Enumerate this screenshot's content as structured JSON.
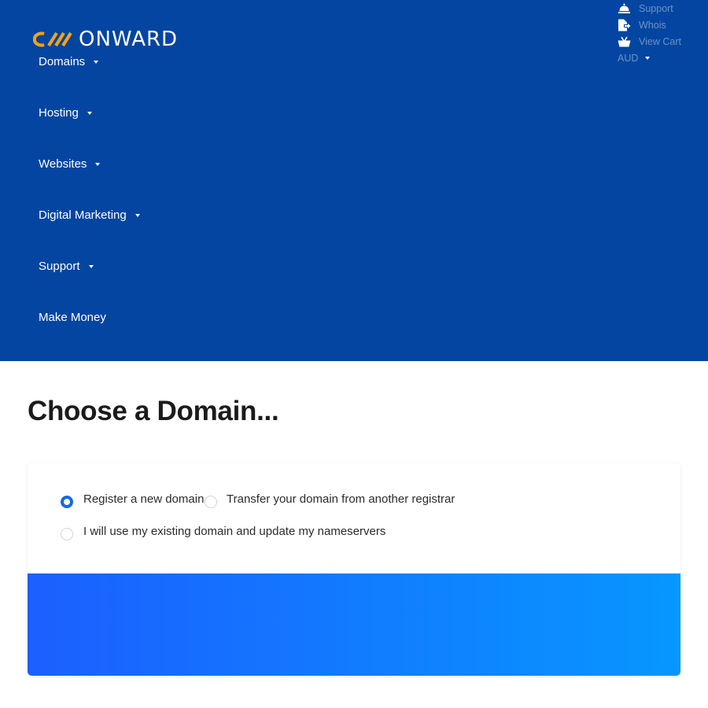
{
  "brand": {
    "name": "ONWARD",
    "logo_colors": [
      "#f0a21c"
    ]
  },
  "colors": {
    "header_bg": "#0345a1",
    "accent": "#1468e6",
    "gradient_start": "#1c5fff",
    "gradient_end": "#0797ff"
  },
  "topbar": {
    "links": [
      {
        "label": "Support",
        "icon": "bell-icon"
      },
      {
        "label": "Whois",
        "icon": "file-arrow-icon"
      },
      {
        "label": "View Cart",
        "icon": "basket-icon"
      }
    ],
    "currency": "AUD"
  },
  "nav": {
    "items": [
      {
        "label": "Domains",
        "has_dropdown": true
      },
      {
        "label": "Hosting",
        "has_dropdown": true
      },
      {
        "label": "Websites",
        "has_dropdown": true
      },
      {
        "label": "Digital Marketing",
        "has_dropdown": true
      },
      {
        "label": "Support",
        "has_dropdown": true
      },
      {
        "label": "Make Money",
        "has_dropdown": false
      }
    ]
  },
  "page": {
    "title": "Choose a Domain..."
  },
  "domain_options": [
    {
      "label": "Register a new domain",
      "checked": true
    },
    {
      "label": "Transfer your domain from another registrar",
      "checked": false
    },
    {
      "label": "I will use my existing domain and update my nameservers",
      "checked": false
    }
  ]
}
